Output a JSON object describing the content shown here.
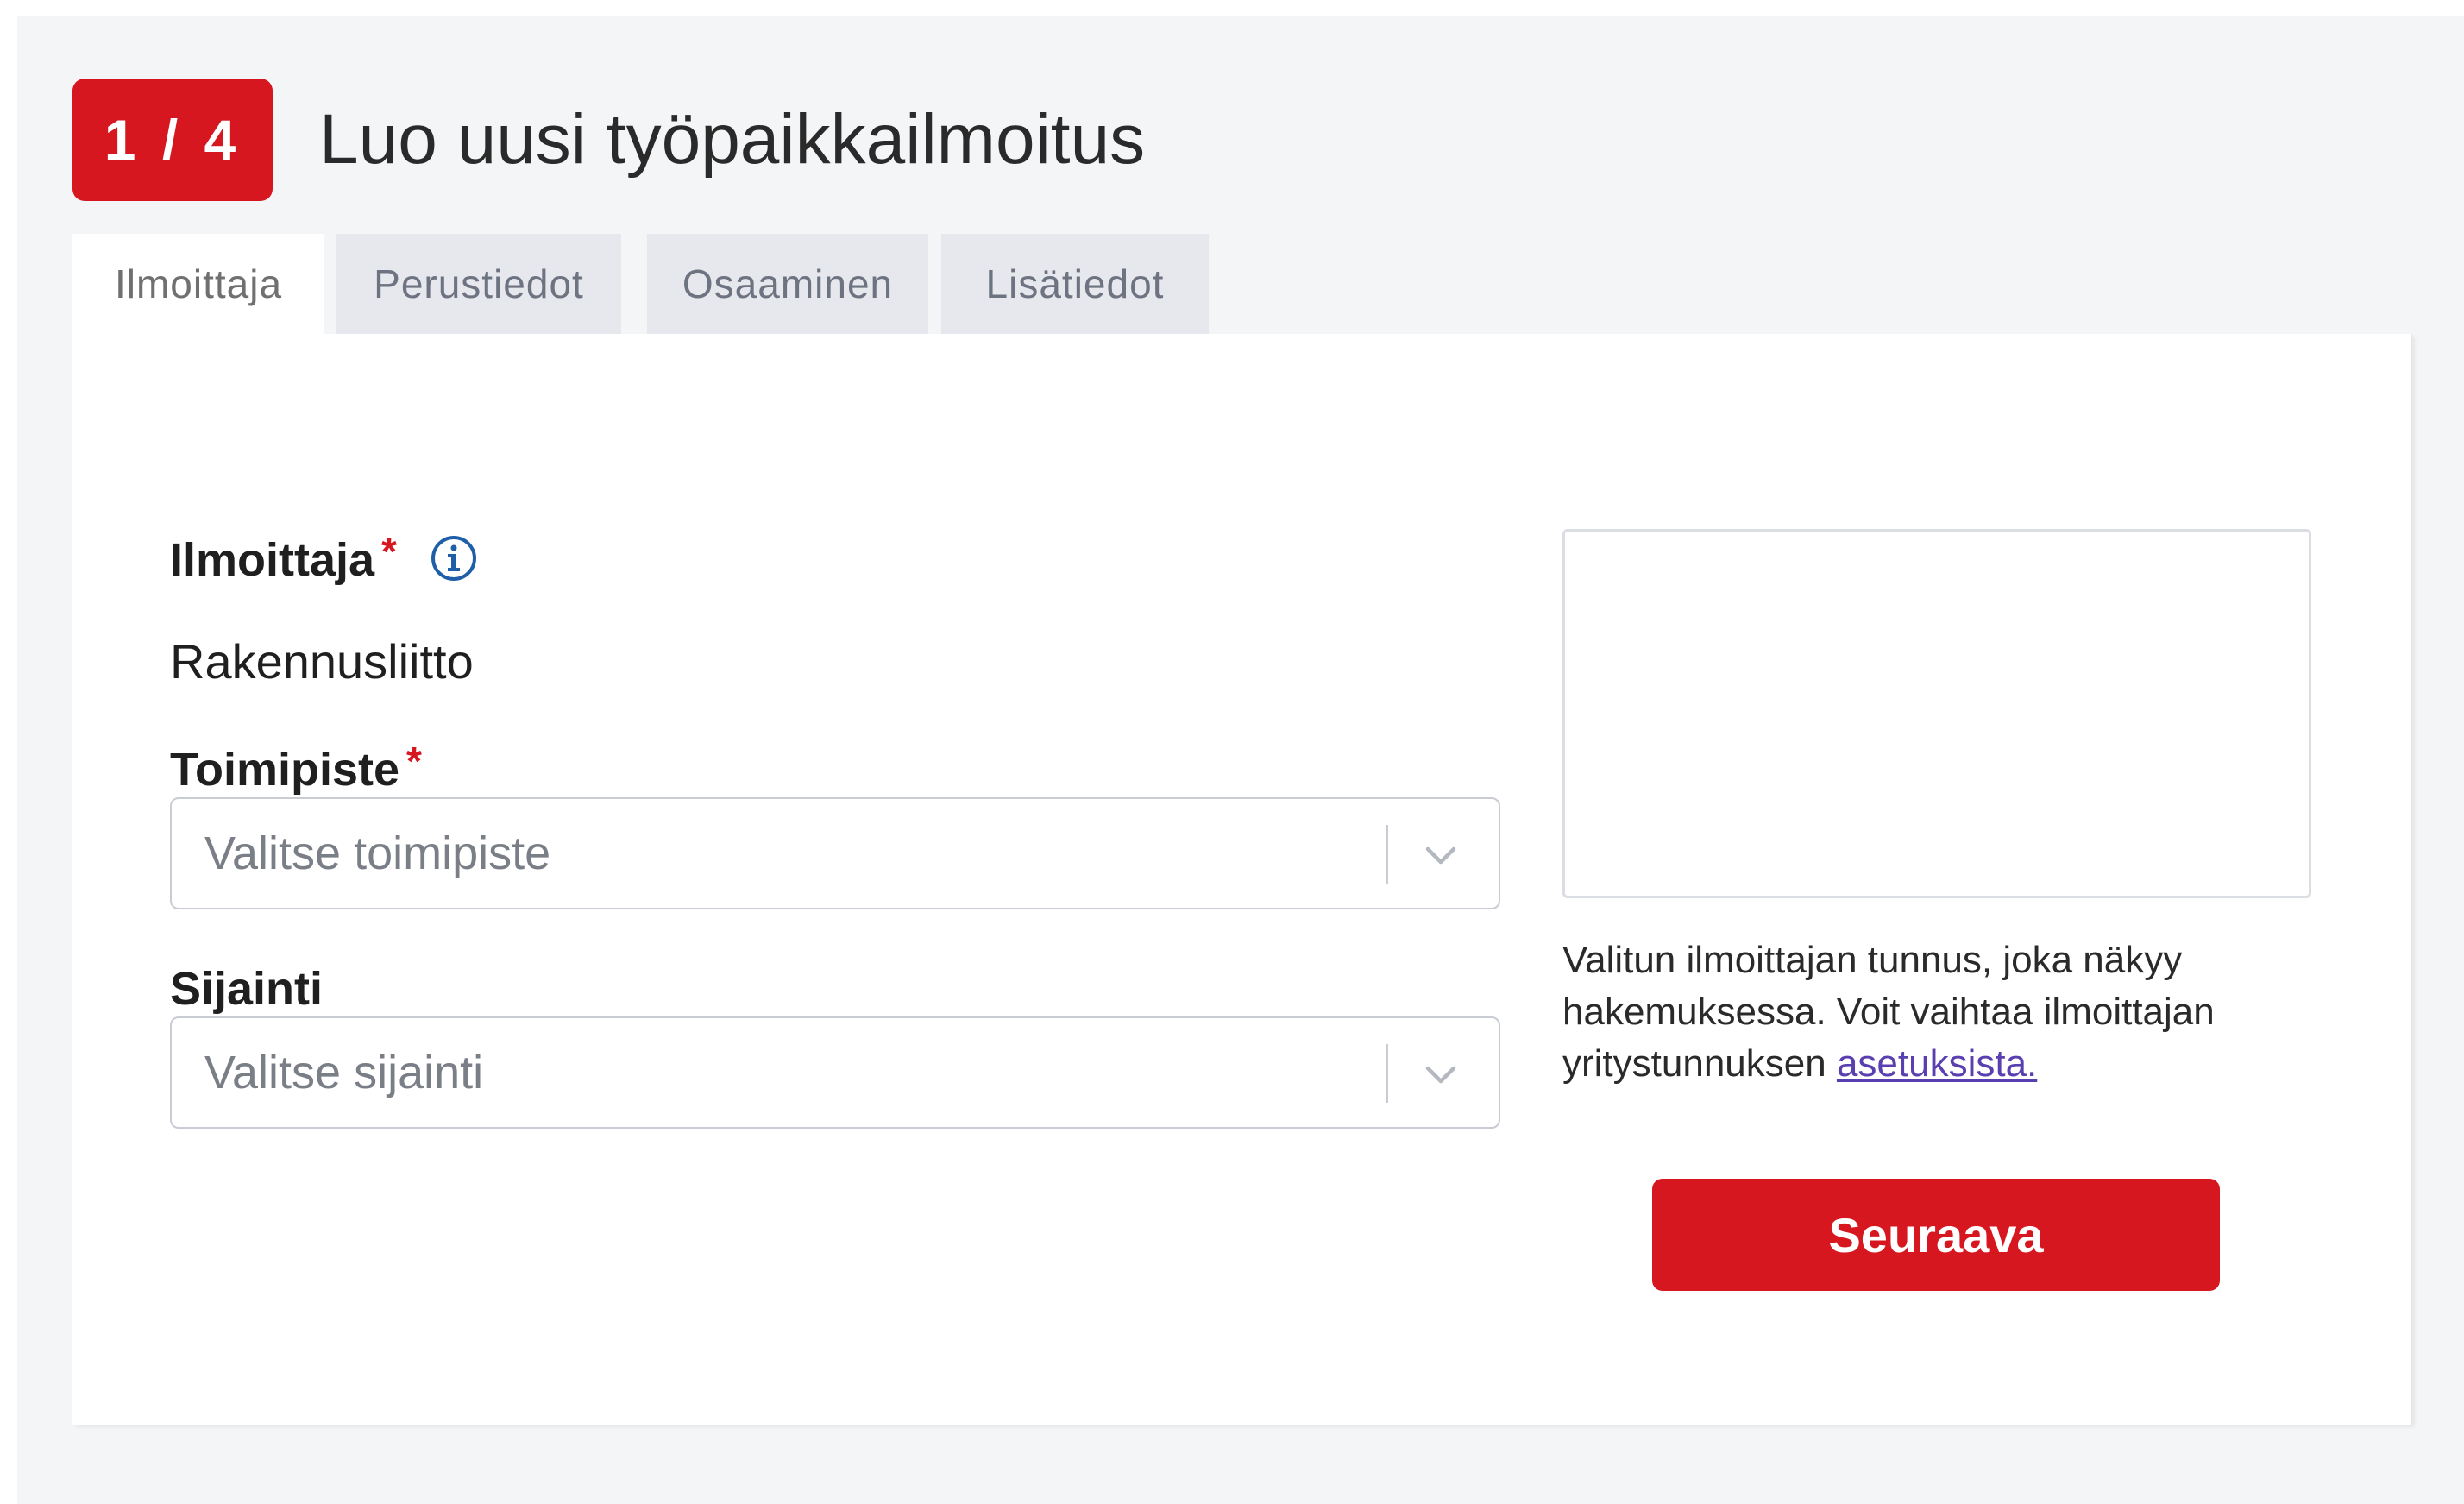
{
  "header": {
    "step_badge": "1 / 4",
    "title": "Luo uusi työpaikkailmoitus"
  },
  "tabs": [
    {
      "label": "Ilmoittaja",
      "active": true
    },
    {
      "label": "Perustiedot",
      "active": false
    },
    {
      "label": "Osaaminen",
      "active": false
    },
    {
      "label": "Lisätiedot",
      "active": false
    }
  ],
  "form": {
    "advertiser": {
      "label": "Ilmoittaja",
      "required_mark": "*",
      "icon": "info-icon",
      "value": "Rakennusliitto"
    },
    "office": {
      "label": "Toimipiste",
      "required_mark": "*",
      "placeholder": "Valitse toimipiste",
      "icon": "chevron-down-icon"
    },
    "location": {
      "label": "Sijainti",
      "placeholder": "Valitse sijainti",
      "icon": "chevron-down-icon"
    }
  },
  "sidebar": {
    "help_text": "Valitun ilmoittajan tunnus, joka näkyy hakemuksessa. Voit vaihtaa ilmoittajan yritystunnuksen ",
    "help_link": "asetuksista."
  },
  "actions": {
    "next_label": "Seuraava"
  },
  "colors": {
    "accent": "#d7171f",
    "link": "#5a3fb0",
    "info": "#1f5fa8",
    "background": "#f4f5f7"
  }
}
